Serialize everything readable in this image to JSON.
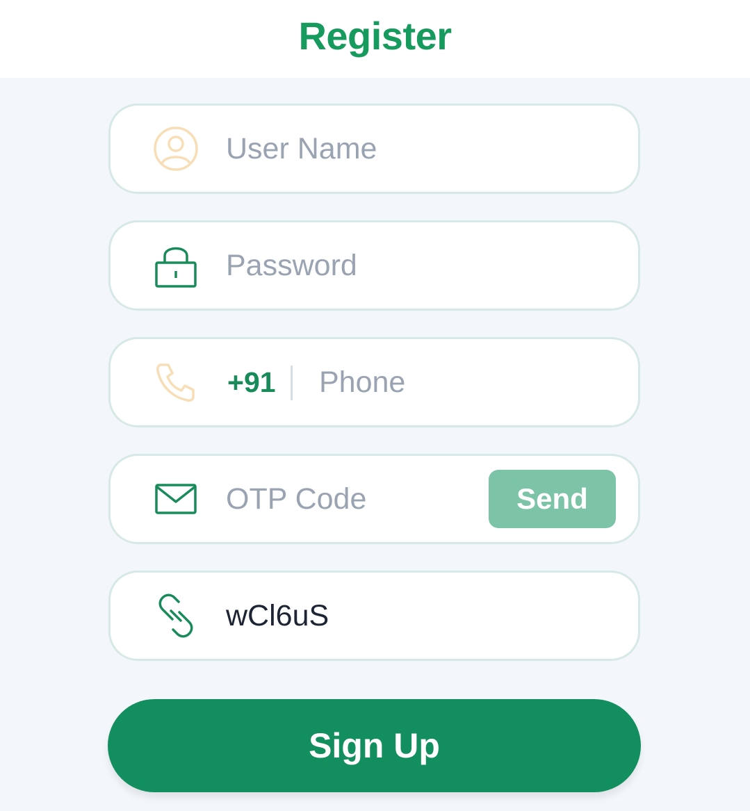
{
  "header": {
    "title": "Register"
  },
  "form": {
    "username": {
      "placeholder": "User Name",
      "value": ""
    },
    "password": {
      "placeholder": "Password",
      "value": ""
    },
    "phone": {
      "country_code": "+91",
      "placeholder": "Phone",
      "value": ""
    },
    "otp": {
      "placeholder": "OTP Code",
      "value": "",
      "send_label": "Send"
    },
    "invite": {
      "value": "wCl6uS"
    },
    "submit_label": "Sign Up"
  },
  "icons": {
    "username": "user-icon",
    "password": "lock-icon",
    "phone": "phone-icon",
    "otp": "mail-icon",
    "invite": "link-icon"
  },
  "colors": {
    "brand_green": "#138e5f",
    "title_green": "#169a5d",
    "send_button": "#7dc3a7",
    "muted_icon": "#f7deb6",
    "placeholder": "#9aa3b2",
    "background": "#f3f7fb"
  }
}
